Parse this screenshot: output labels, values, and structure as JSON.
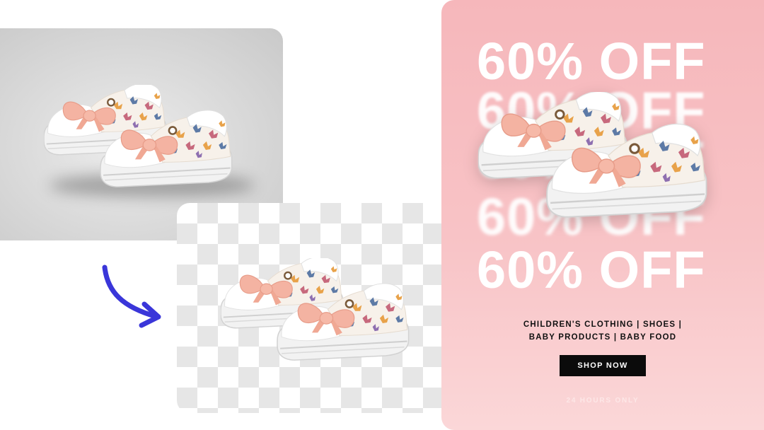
{
  "poster": {
    "offer_lines": [
      "60% OFF",
      "60% OFF",
      "60% OFF",
      "60% OFF",
      "60% OFF"
    ],
    "categories_line1": "CHILDREN'S CLOTHING | SHOES |",
    "categories_line2": "BABY PRODUCTS | BABY FOOD",
    "cta_label": "SHOP NOW",
    "footer_note": "24 HOURS ONLY",
    "background_color": "#f6b7bb"
  },
  "images": {
    "original": "shoes-photo-grey-background",
    "cutout": "shoes-cutout-transparent-background",
    "poster": "shoes-on-poster"
  },
  "arrow": {
    "icon": "curved-arrow-icon",
    "color": "#3a36d9"
  }
}
